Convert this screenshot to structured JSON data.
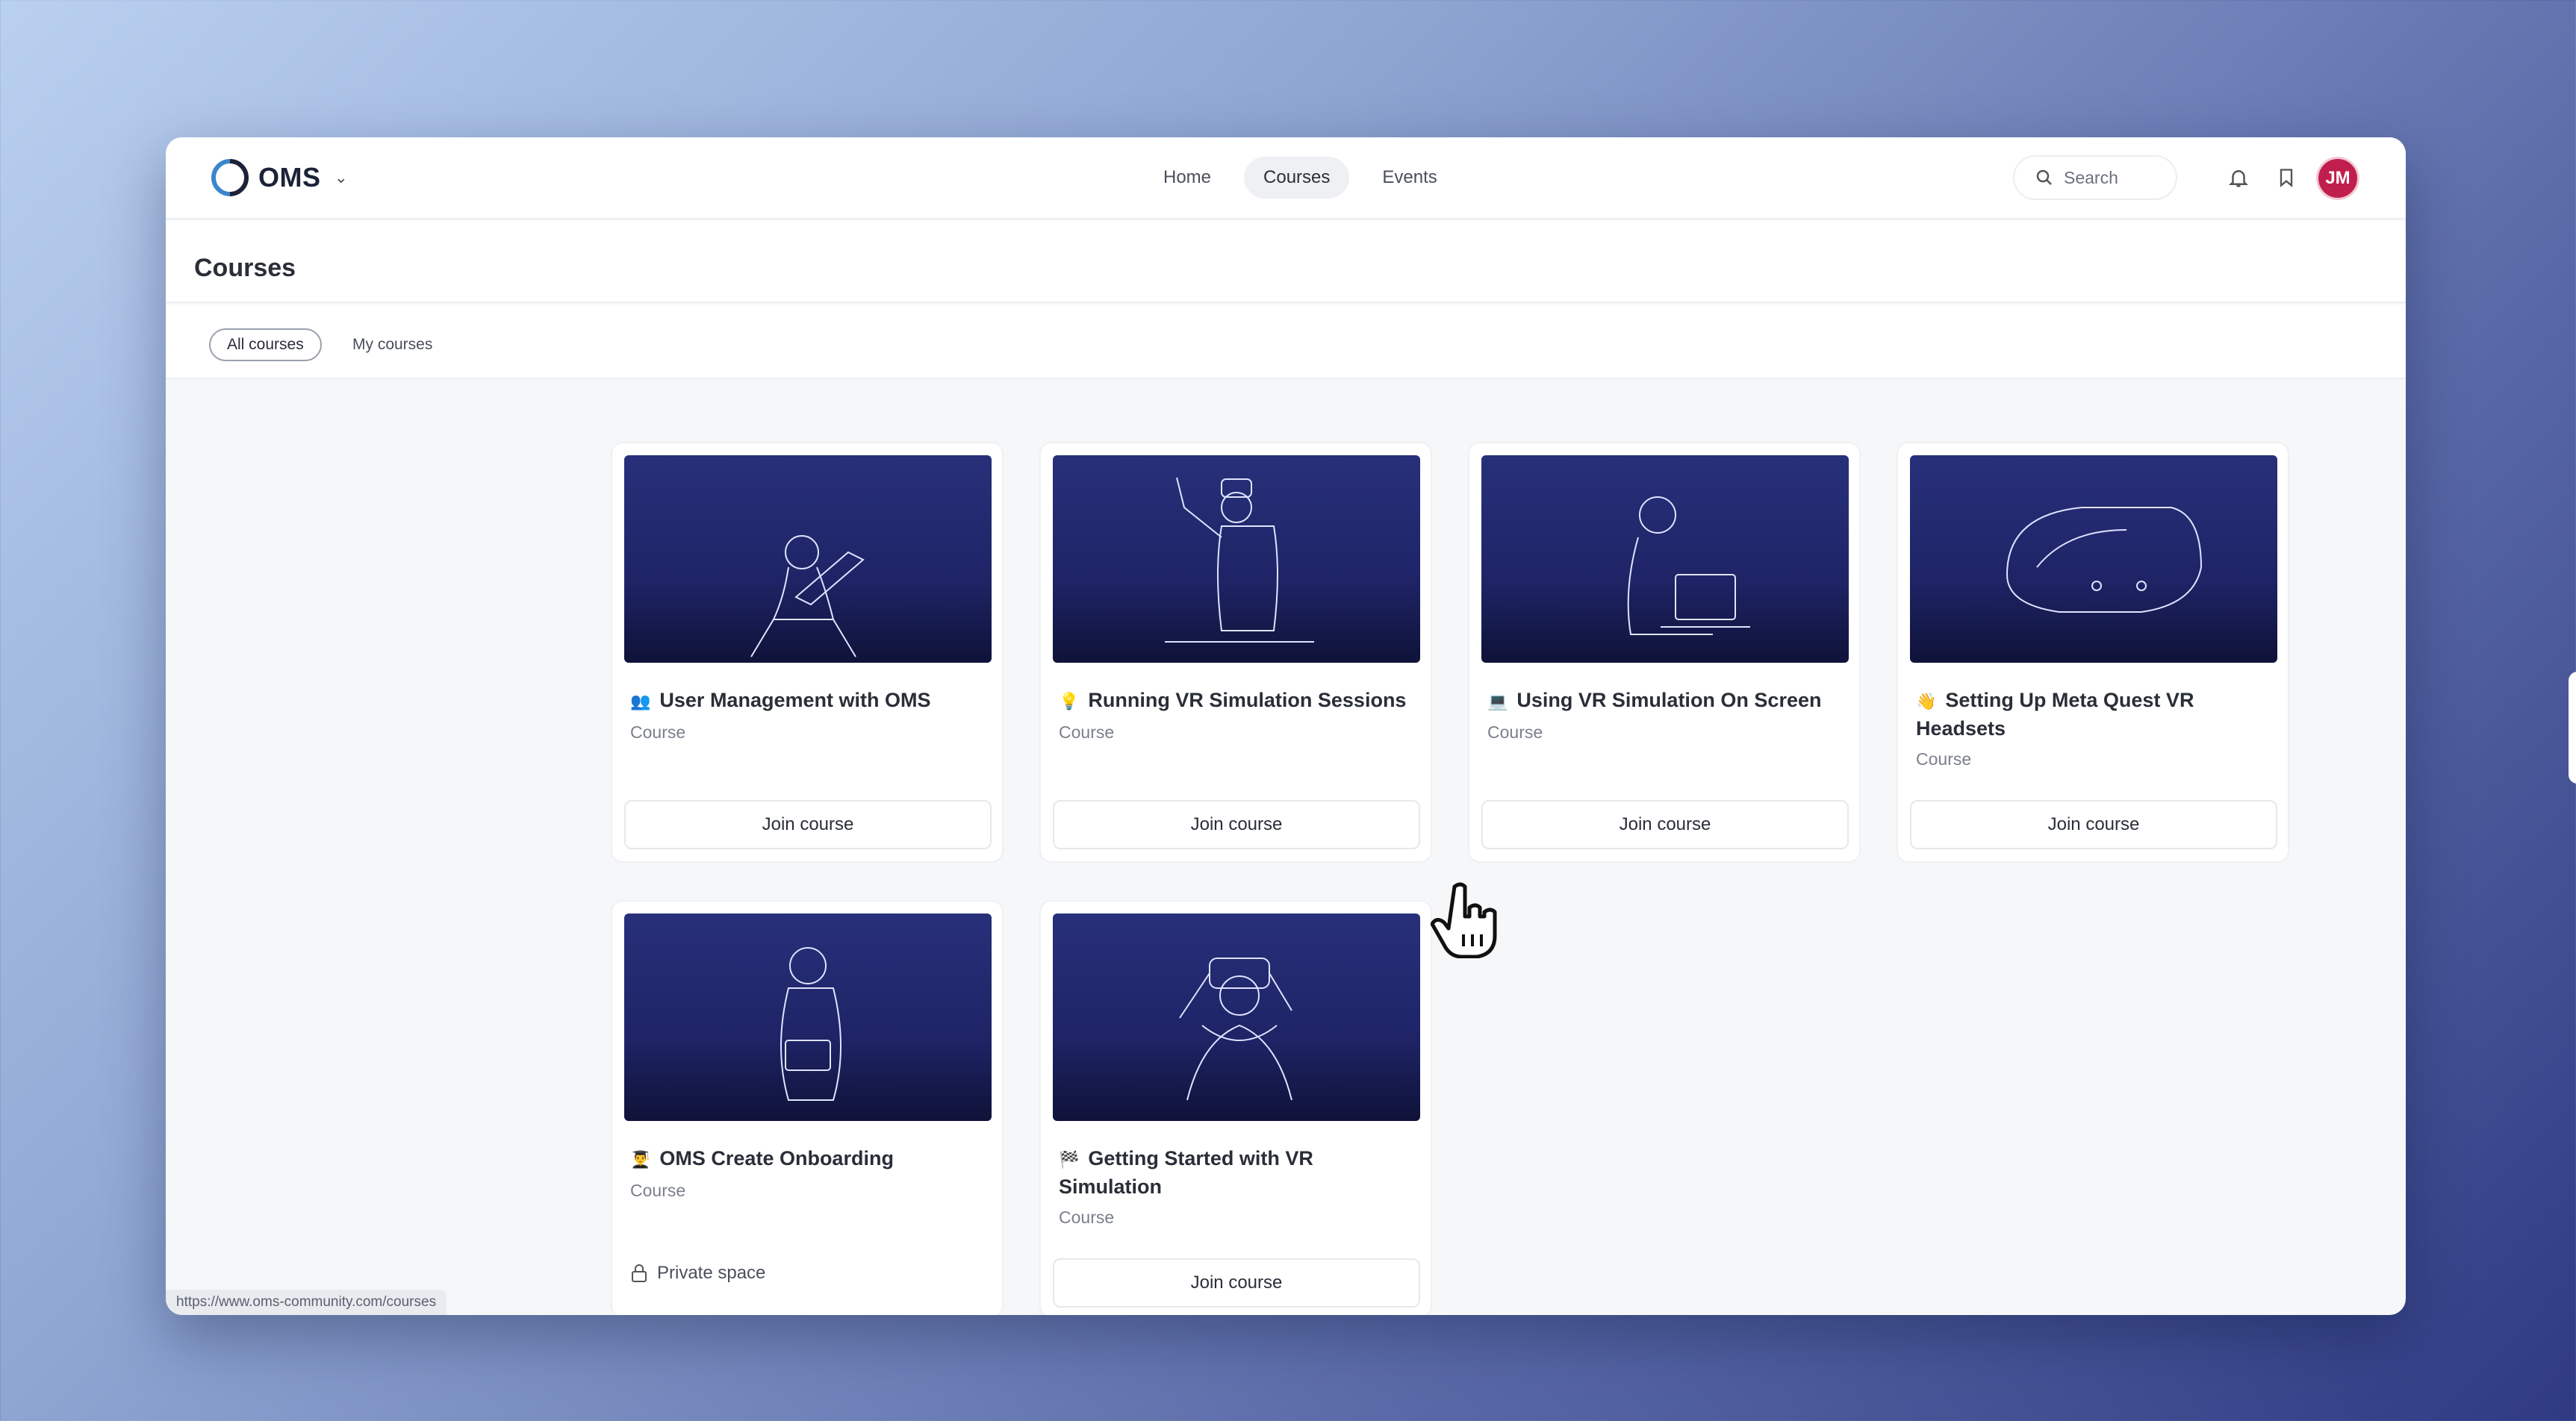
{
  "app": {
    "logo_text": "OMS"
  },
  "nav": {
    "items": [
      "Home",
      "Courses",
      "Events"
    ],
    "active": "Courses"
  },
  "search": {
    "placeholder": "Search"
  },
  "user": {
    "initials": "JM",
    "avatar_color": "#c01f4e"
  },
  "page": {
    "title": "Courses"
  },
  "filters": {
    "all": "All courses",
    "mine": "My courses"
  },
  "courses": [
    {
      "emoji": "👥",
      "title": "User Management with OMS",
      "type": "Course",
      "action": "Join course"
    },
    {
      "emoji": "💡",
      "title": "Running VR Simulation Sessions",
      "type": "Course",
      "action": "Join course"
    },
    {
      "emoji": "💻",
      "title": "Using VR Simulation On Screen",
      "type": "Course",
      "action": "Join course"
    },
    {
      "emoji": "👋",
      "title": "Setting Up Meta Quest VR Headsets",
      "type": "Course",
      "action": "Join course"
    },
    {
      "emoji": "👨‍🎓",
      "title": "OMS Create Onboarding",
      "type": "Course",
      "private_label": "Private space"
    },
    {
      "emoji": "🏁",
      "title": "Getting Started with VR Simulation",
      "type": "Course",
      "action": "Join course"
    }
  ],
  "status_bar": {
    "url": "https://www.oms-community.com/courses"
  },
  "colors": {
    "card_banner": "#1e2466",
    "accent": "#c01f4e"
  }
}
